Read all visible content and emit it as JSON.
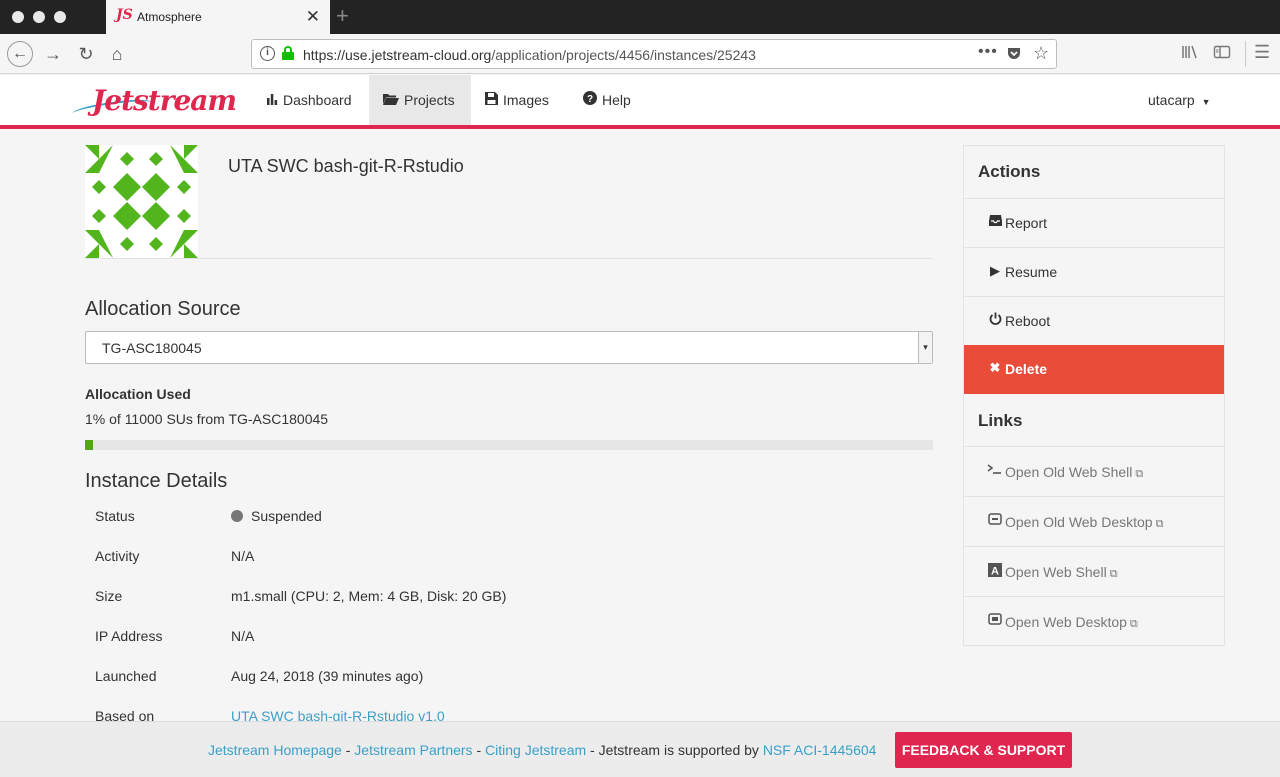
{
  "browser": {
    "tab_title": "Atmosphere",
    "tab_favicon": "JS",
    "url_host": "https://use.jetstream-cloud.org",
    "url_path": "/application/projects/4456/instances/25243"
  },
  "app": {
    "logo_text": "Jetstream",
    "nav": [
      {
        "label": "Dashboard",
        "icon": "bar-chart-icon"
      },
      {
        "label": "Projects",
        "icon": "folder-open-icon"
      },
      {
        "label": "Images",
        "icon": "floppy-icon"
      },
      {
        "label": "Help",
        "icon": "question-circle-icon"
      }
    ],
    "user": "utacarp"
  },
  "instance": {
    "name": "UTA SWC bash-git-R-Rstudio"
  },
  "allocation": {
    "section_title": "Allocation Source",
    "selected": "TG-ASC180045",
    "used_label": "Allocation Used",
    "used_text": "1% of 11000 SUs from TG-ASC180045",
    "used_percent": 1
  },
  "details": {
    "section_title": "Instance Details",
    "rows": [
      {
        "label": "Status",
        "value": "Suspended"
      },
      {
        "label": "Activity",
        "value": "N/A"
      },
      {
        "label": "Size",
        "value": "m1.small (CPU: 2, Mem: 4 GB, Disk: 20 GB)"
      },
      {
        "label": "IP Address",
        "value": "N/A"
      },
      {
        "label": "Launched",
        "value": "Aug 24, 2018 (39 minutes ago)"
      },
      {
        "label": "Based on",
        "value": "UTA SWC bash-git-R-Rstudio v1.0"
      }
    ]
  },
  "sidebar": {
    "actions_heading": "Actions",
    "actions": [
      {
        "label": "Report",
        "icon": "inbox-icon"
      },
      {
        "label": "Resume",
        "icon": "play-icon"
      },
      {
        "label": "Reboot",
        "icon": "power-icon"
      },
      {
        "label": "Delete",
        "icon": "times-icon"
      }
    ],
    "links_heading": "Links",
    "links": [
      {
        "label": "Open Old Web Shell",
        "icon": "terminal-icon"
      },
      {
        "label": "Open Old Web Desktop",
        "icon": "desktop-icon"
      },
      {
        "label": "Open Web Shell",
        "icon": "guacamole-shell-icon"
      },
      {
        "label": "Open Web Desktop",
        "icon": "guacamole-desktop-icon"
      }
    ]
  },
  "footer": {
    "link1": "Jetstream Homepage",
    "link2": "Jetstream Partners",
    "link3": "Citing Jetstream",
    "supported_text": "Jetstream is supported by",
    "link4": "NSF ACI-1445604",
    "sep": " - ",
    "feedback_button": "FEEDBACK & SUPPORT"
  },
  "colors": {
    "brand": "#e0254e",
    "link": "#3aa0c8",
    "delete": "#ea4c3a",
    "identicon": "#52b51e",
    "progress": "#52a61c"
  }
}
